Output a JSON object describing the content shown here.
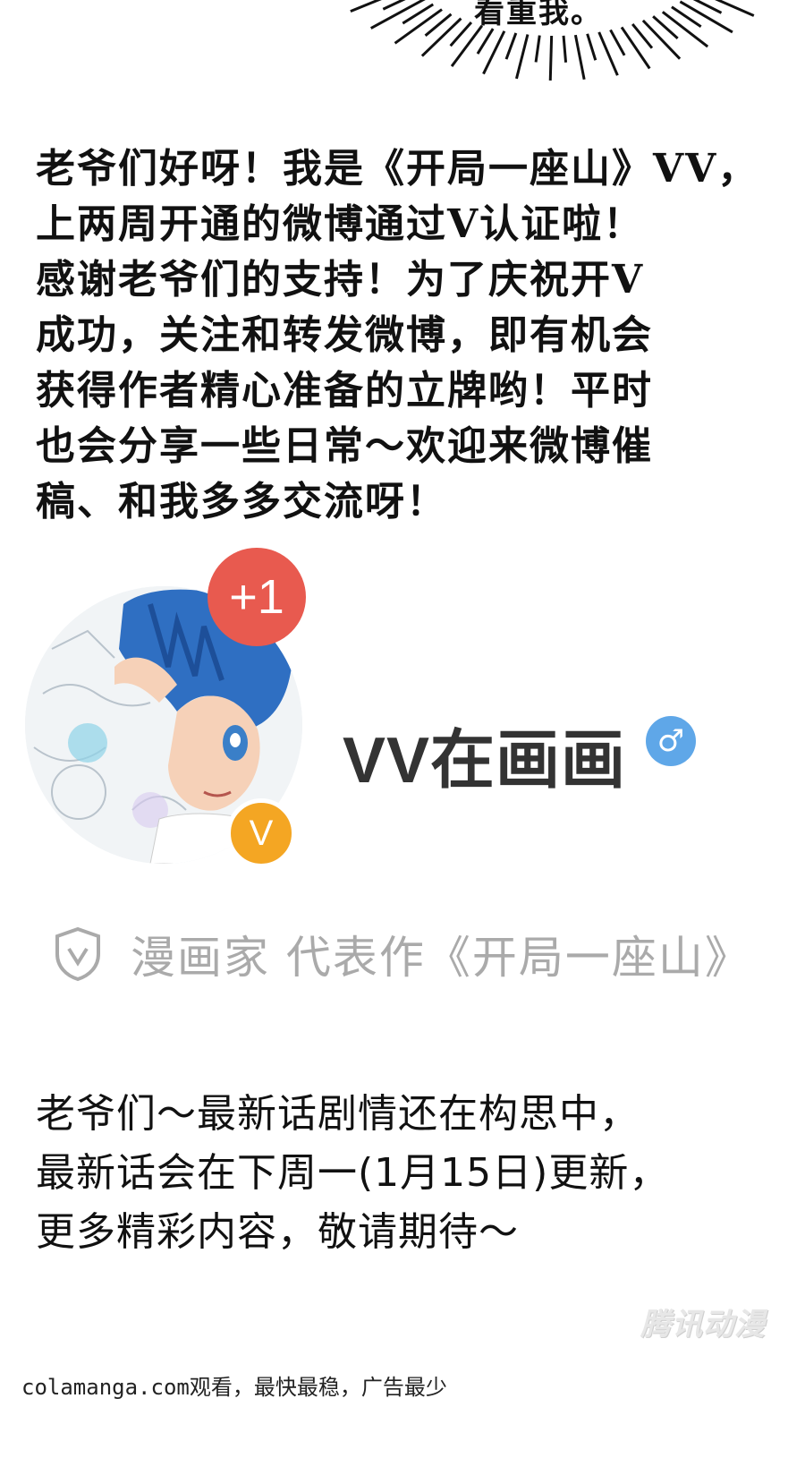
{
  "speech_bubble": {
    "text": "看重我。"
  },
  "intro": {
    "lines": [
      "老爷们好呀！我是《开局一座山》VV，",
      "上两周开通的微博通过V认证啦！",
      "感谢老爷们的支持！为了庆祝开V",
      "成功，关注和转发微博，即有机会",
      "获得作者精心准备的立牌哟！平时",
      "也会分享一些日常～欢迎来微博催",
      "稿、和我多多交流呀！"
    ]
  },
  "profile": {
    "notification_badge": "+1",
    "verified_badge": "V",
    "username": "VV在画画",
    "gender_symbol": "♂",
    "verification": "漫画家 代表作《开局一座山》"
  },
  "notice": {
    "lines": [
      "老爷们～最新话剧情还在构思中，",
      "最新话会在下周一(1月15日)更新，",
      "更多精彩内容，敬请期待～"
    ]
  },
  "watermark": "腾讯动漫",
  "footer": "colamanga.com观看，最快最稳，广告最少",
  "colors": {
    "badge_red": "#e85a4f",
    "badge_orange": "#f4a623",
    "gender_blue": "#5fa7e8",
    "verify_gray": "#aaaaaa"
  }
}
